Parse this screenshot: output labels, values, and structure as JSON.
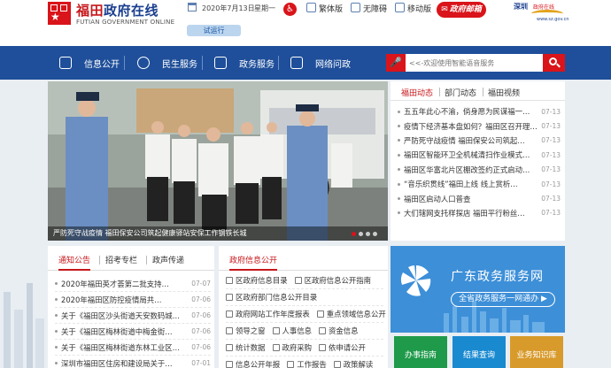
{
  "header": {
    "site_title_a": "福田",
    "site_title_b": "政府在线",
    "site_title_en": "FUTIAN GOVERNMENT ONLINE",
    "trial_label": "试运行",
    "date": "2020年7月13日",
    "weekday": "星期一",
    "top_links": [
      "繁体版",
      "无障碍",
      "移动版"
    ],
    "mailbox_label": "政府邮箱",
    "sz_logo_a": "深圳",
    "sz_logo_b": "政府在线",
    "sz_logo_url": "www.sz.gov.cn"
  },
  "nav": {
    "items": [
      "信息公开",
      "民生服务",
      "政务服务",
      "网络问政"
    ]
  },
  "search": {
    "placeholder": "<<-欢迎使用智能语音服务"
  },
  "slide": {
    "caption": "严防死守战疫情 福田保安公司筑起健康驿站安保工作钢铁长城"
  },
  "news": {
    "tabs": [
      "福田动态",
      "部门动态",
      "福田视频"
    ],
    "items": [
      {
        "title": "五五年此心不渝，倘身愿为民谋福一…",
        "date": "07-13"
      },
      {
        "title": "疫情下经济基本盘如何？福田区召开理…",
        "date": "07-13"
      },
      {
        "title": "严防死守战疫情 福田保安公司筑起…",
        "date": "07-13"
      },
      {
        "title": "福田区智能环卫全机械清扫作业模式…",
        "date": "07-13"
      },
      {
        "title": "福田区华富北片区棚改签约正式启动…",
        "date": "07-13"
      },
      {
        "title": "“音乐织贯线”福田上线 线上赏析…",
        "date": "07-13"
      },
      {
        "title": "福田区启动人口普查",
        "date": "07-13"
      },
      {
        "title": "大们辖网支托样探店 福田平行粉丝…",
        "date": "07-13"
      }
    ]
  },
  "notice": {
    "tabs": [
      "通知公告",
      "招考专栏",
      "政声传递"
    ],
    "items": [
      {
        "title": "2020年福田英才荟第二批支持…",
        "date": "07-07"
      },
      {
        "title": "2020年福田区防控疫情局共…",
        "date": "07-06"
      },
      {
        "title": "关于《福田区沙头街道天安数码城…",
        "date": "07-06"
      },
      {
        "title": "关于《福田区梅林街道中梅金街…",
        "date": "07-06"
      },
      {
        "title": "关于《福田区梅林街道东林工业区…",
        "date": "07-06"
      },
      {
        "title": "深圳市福田区住房和建设局关于…",
        "date": "07-01"
      }
    ]
  },
  "info": {
    "tab": "政府信息公开",
    "rows": [
      [
        "区政府信息目录",
        "区政府信息公开指南"
      ],
      [
        "区政府部门信息公开目录"
      ],
      [
        "政府网站工作年度报表",
        "重点领域信息公开"
      ],
      [
        "领导之窗",
        "人事信息",
        "资金信息"
      ],
      [
        "统计数据",
        "政府采购",
        "依申请公开"
      ],
      [
        "信息公开年报",
        "工作报告",
        "政策解读"
      ]
    ]
  },
  "service": {
    "title": "广东政务服务网",
    "button": "全省政务服务一网通办 ▶",
    "quick": [
      {
        "label": "办事指南",
        "color": "#1e9a4a"
      },
      {
        "label": "结果查询",
        "color": "#1a8ad0"
      },
      {
        "label": "业务知识库",
        "color": "#d89a2a"
      }
    ]
  }
}
